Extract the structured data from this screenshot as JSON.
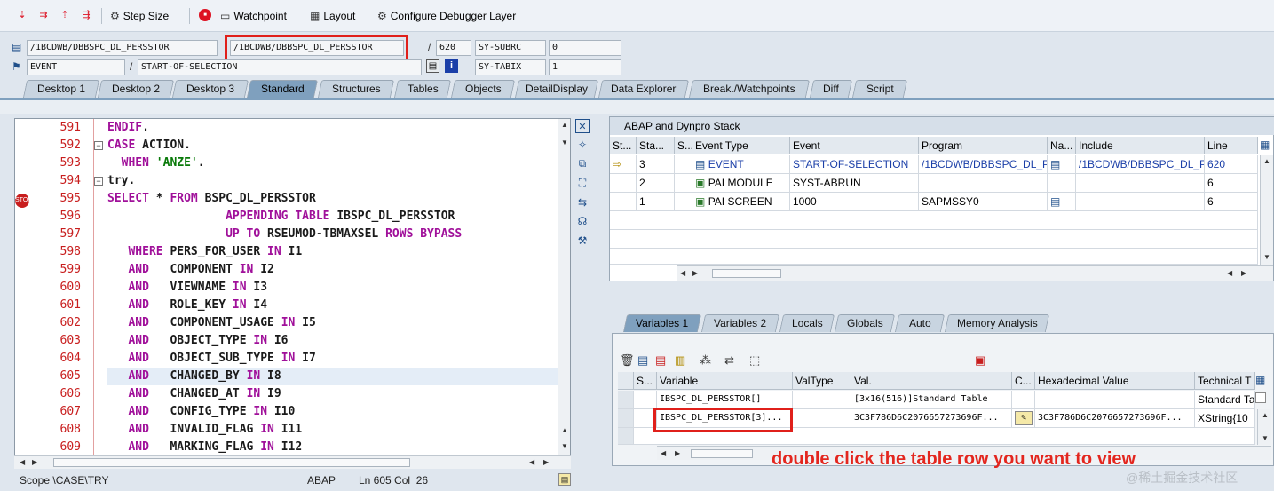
{
  "toolbar": {
    "step_size": "Step Size",
    "watchpoint": "Watchpoint",
    "layout": "Layout",
    "configure": "Configure Debugger Layer"
  },
  "header": {
    "program": "/1BCDWB/DBBSPC_DL_PERSSTOR",
    "include": "/1BCDWB/DBBSPC_DL_PERSSTOR",
    "line": "620",
    "sysubrc_label": "SY-SUBRC",
    "sysubrc_value": "0",
    "event_type": "EVENT",
    "event": "START-OF-SELECTION",
    "sytabix_label": "SY-TABIX",
    "sytabix_value": "1"
  },
  "tabs": [
    "Desktop 1",
    "Desktop 2",
    "Desktop 3",
    "Standard",
    "Structures",
    "Tables",
    "Objects",
    "DetailDisplay",
    "Data Explorer",
    "Break./Watchpoints",
    "Diff",
    "Script"
  ],
  "code": {
    "lines": [
      {
        "n": "591",
        "t": "ENDIF."
      },
      {
        "n": "592",
        "t": "CASE ACTION."
      },
      {
        "n": "593",
        "t": "  WHEN 'ANZE'."
      },
      {
        "n": "594",
        "t": "try."
      },
      {
        "n": "595",
        "t": "SELECT * FROM BSPC_DL_PERSSTOR"
      },
      {
        "n": "596",
        "t": "                 APPENDING TABLE IBSPC_DL_PERSSTOR"
      },
      {
        "n": "597",
        "t": "                 UP TO RSEUMOD-TBMAXSEL ROWS BYPASS"
      },
      {
        "n": "598",
        "t": "   WHERE PERS_FOR_USER IN I1"
      },
      {
        "n": "599",
        "t": "   AND   COMPONENT IN I2"
      },
      {
        "n": "600",
        "t": "   AND   VIEWNAME IN I3"
      },
      {
        "n": "601",
        "t": "   AND   ROLE_KEY IN I4"
      },
      {
        "n": "602",
        "t": "   AND   COMPONENT_USAGE IN I5"
      },
      {
        "n": "603",
        "t": "   AND   OBJECT_TYPE IN I6"
      },
      {
        "n": "604",
        "t": "   AND   OBJECT_SUB_TYPE IN I7"
      },
      {
        "n": "605",
        "t": "   AND   CHANGED_BY IN I8"
      },
      {
        "n": "606",
        "t": "   AND   CHANGED_AT IN I9"
      },
      {
        "n": "607",
        "t": "   AND   CONFIG_TYPE IN I10"
      },
      {
        "n": "608",
        "t": "   AND   INVALID_FLAG IN I11"
      },
      {
        "n": "609",
        "t": "   AND   MARKING_FLAG IN I12"
      }
    ]
  },
  "status": {
    "scope": "Scope \\CASE\\TRY",
    "lang": "ABAP",
    "pos": "Ln 605 Col  26"
  },
  "stack": {
    "title": "ABAP and Dynpro Stack",
    "headers": [
      "St...",
      "Sta...",
      "S...",
      "Event Type",
      "Event",
      "Program",
      "Na...",
      "Include",
      "Line"
    ],
    "rows": [
      {
        "sta": "3",
        "type": "EVENT",
        "event": "START-OF-SELECTION",
        "program": "/1BCDWB/DBBSPC_DL_P...",
        "include": "/1BCDWB/DBBSPC_DL_P...",
        "line": "620"
      },
      {
        "sta": "2",
        "type": "PAI MODULE",
        "event": "SYST-ABRUN",
        "program": "",
        "include": "",
        "line": "6"
      },
      {
        "sta": "1",
        "type": "PAI SCREEN",
        "event": "1000",
        "program": "SAPMSSY0",
        "include": "",
        "line": "6"
      }
    ]
  },
  "var_tabs": [
    "Variables 1",
    "Variables 2",
    "Locals",
    "Globals",
    "Auto",
    "Memory Analysis"
  ],
  "vars": {
    "headers": [
      "S...",
      "Variable",
      "ValType",
      "Val.",
      "C...",
      "Hexadecimal Value",
      "Technical T"
    ],
    "rows": [
      {
        "var": "IBSPC_DL_PERSSTOR[]",
        "valtype": "",
        "val": "[3x16(516)]Standard Table",
        "hex": "",
        "tech": "Standard Ta"
      },
      {
        "var": "IBSPC_DL_PERSSTOR[3]...",
        "valtype": "",
        "val": "3C3F786D6C2076657273696F...",
        "hex": "3C3F786D6C2076657273696F...",
        "tech": "XString{10"
      }
    ]
  },
  "annotation": "double click the table row you want to view",
  "watermark": "@稀土掘金技术社区"
}
